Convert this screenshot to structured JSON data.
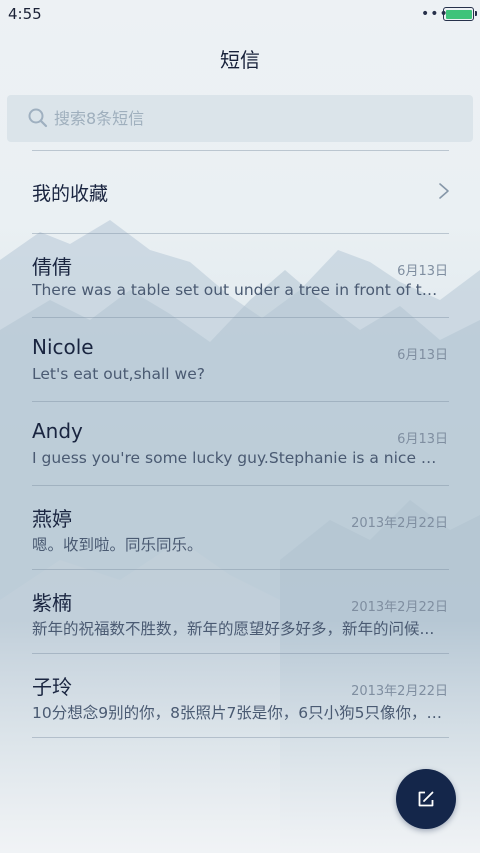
{
  "status_bar": {
    "time": "4:55",
    "dots": "•••",
    "battery_level": 1.0,
    "battery_color": "#3ec37a"
  },
  "header": {
    "title": "短信"
  },
  "search": {
    "placeholder": "搜索8条短信",
    "value": "",
    "icon": "search-icon"
  },
  "favorites": {
    "label": "我的收藏",
    "icon": "chevron-right-icon"
  },
  "messages": [
    {
      "name": "倩倩",
      "date": "6月13日",
      "preview": "There was a table set out under a tree in front of the ho..."
    },
    {
      "name": "Nicole",
      "date": "6月13日",
      "preview": "Let's eat out,shall we?"
    },
    {
      "name": "Andy",
      "date": "6月13日",
      "preview": "I guess you're some lucky guy.Stephanie is a nice girl."
    },
    {
      "name": "燕婷",
      "date": "2013年2月22日",
      "preview": "嗯。收到啦。同乐同乐。"
    },
    {
      "name": "紫楠",
      "date": "2013年2月22日",
      "preview": "新年的祝福数不胜数，新年的愿望好多好多，新年的问候..."
    },
    {
      "name": "子玲",
      "date": "2013年2月22日",
      "preview": "10分想念9别的你，8张照片7张是你，6只小狗5只像你，4..."
    }
  ],
  "fab": {
    "icon": "compose-icon",
    "color": "#14264a"
  },
  "colors": {
    "accent": "#14264a",
    "text_primary": "#1a2540",
    "text_secondary": "#4a5a72",
    "date_text": "#7f8ea0"
  }
}
